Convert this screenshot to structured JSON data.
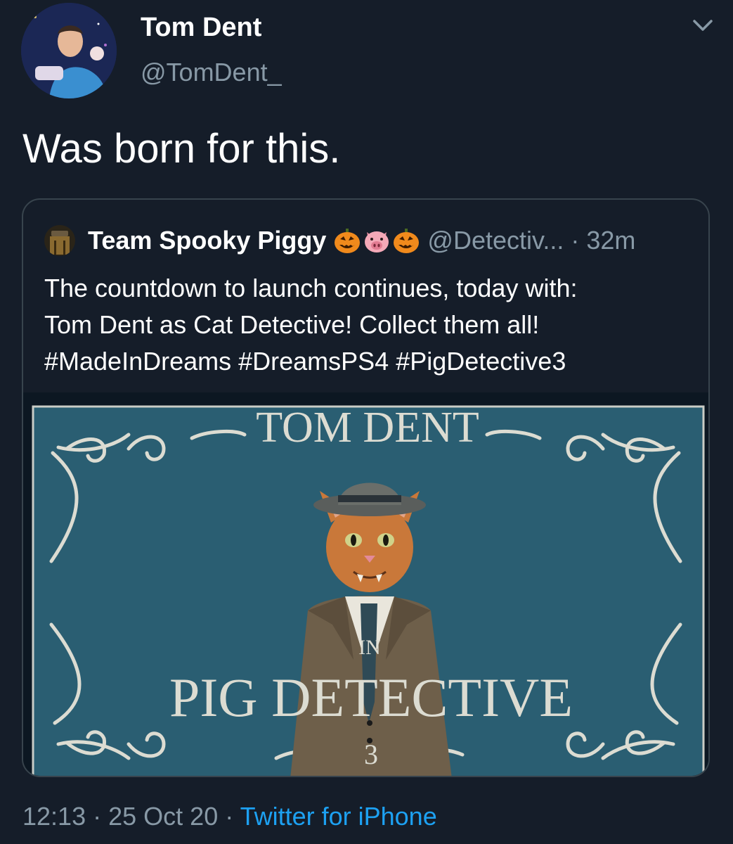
{
  "author": {
    "display_name": "Tom Dent",
    "handle": "@TomDent_"
  },
  "tweet": {
    "text": "Was born for this."
  },
  "quoted": {
    "display_name": "Team Spooky Piggy",
    "emojis": [
      "jack-o-lantern",
      "pig-face",
      "jack-o-lantern"
    ],
    "handle": "@Detectiv...",
    "separator": "·",
    "time": "32m",
    "text_lines": [
      "The countdown to launch continues, today with:",
      "Tom Dent as Cat Detective! Collect them all!",
      "#MadeInDreams #DreamsPS4 #PigDetective3"
    ],
    "media": {
      "title": "TOM DENT",
      "connector": "IN",
      "subtitle": "PIG DETECTIVE",
      "number": "3",
      "background_color": "#2a5e72",
      "ornament_color": "#d8d8d0"
    }
  },
  "footer": {
    "time": "12:13",
    "separator": "·",
    "date": "25 Oct 20",
    "source": "Twitter for iPhone"
  },
  "colors": {
    "background": "#151d29",
    "secondary_text": "#8899a6",
    "link": "#1da1f2",
    "card_border": "#38444d"
  }
}
